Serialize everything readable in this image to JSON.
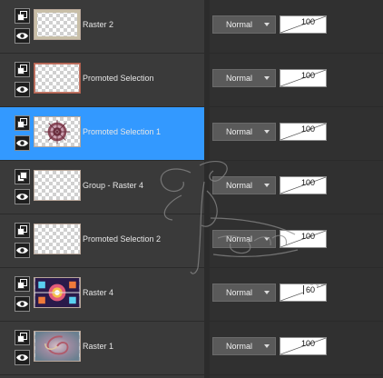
{
  "layers": [
    {
      "name": "Raster 2",
      "type": "raster",
      "blend_mode": "Normal",
      "opacity": "100",
      "opacity_fraction": 1.0,
      "selected": false,
      "thumb": "frame"
    },
    {
      "name": "Promoted Selection",
      "type": "raster",
      "blend_mode": "Normal",
      "opacity": "100",
      "opacity_fraction": 1.0,
      "selected": false,
      "thumb": "red-frame"
    },
    {
      "name": "Promoted Selection 1",
      "type": "raster",
      "blend_mode": "Normal",
      "opacity": "100",
      "opacity_fraction": 1.0,
      "selected": true,
      "thumb": "ornament"
    },
    {
      "name": "Group - Raster 4",
      "type": "group",
      "blend_mode": "Normal",
      "opacity": "100",
      "opacity_fraction": 1.0,
      "selected": false,
      "thumb": "empty"
    },
    {
      "name": "Promoted Selection 2",
      "type": "raster",
      "blend_mode": "Normal",
      "opacity": "100",
      "opacity_fraction": 1.0,
      "selected": false,
      "thumb": "empty"
    },
    {
      "name": "Raster 4",
      "type": "raster",
      "blend_mode": "Normal",
      "opacity": "60",
      "opacity_fraction": 0.6,
      "selected": false,
      "thumb": "colorful"
    },
    {
      "name": "Raster 1",
      "type": "raster",
      "blend_mode": "Normal",
      "opacity": "100",
      "opacity_fraction": 1.0,
      "selected": false,
      "thumb": "swirl"
    }
  ],
  "icons": {
    "layer_type": "layer-type-icon",
    "visibility": "eye-icon",
    "dropdown": "chevron-down-icon"
  },
  "colors": {
    "panel_bg": "#3a3a3a",
    "selected_bg": "#3399ff",
    "dropdown_bg": "#5a5a5a"
  }
}
